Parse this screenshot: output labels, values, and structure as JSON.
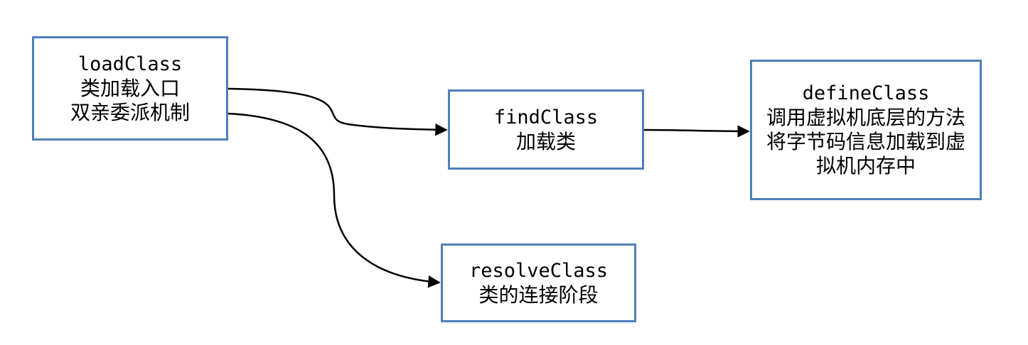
{
  "nodes": {
    "load_class": {
      "code": "loadClass",
      "lines": [
        "类加载入口",
        "双亲委派机制"
      ]
    },
    "find_class": {
      "code": "findClass",
      "lines": [
        "加载类"
      ]
    },
    "define_class": {
      "code": "defineClass",
      "lines": [
        "调用虚拟机底层的方法",
        "将字节码信息加载到虚",
        "拟机内存中"
      ]
    },
    "resolve_class": {
      "code": "resolveClass",
      "lines": [
        "类的连接阶段"
      ]
    }
  },
  "colors": {
    "box_border": "#4f7fba",
    "edge": "#000000",
    "text": "#000000"
  }
}
